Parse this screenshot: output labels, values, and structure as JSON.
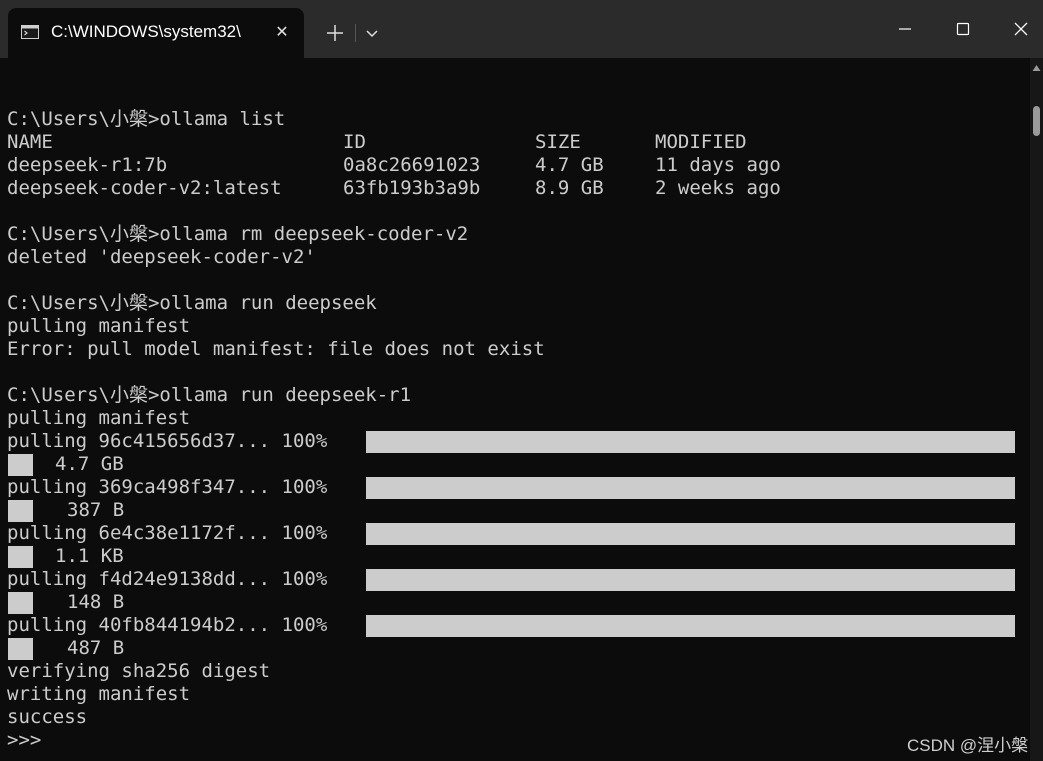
{
  "window": {
    "tab_title": "C:\\WINDOWS\\system32\\",
    "close_tab_glyph": "✕",
    "icons": [
      "terminal-icon",
      "close-icon",
      "plus-icon",
      "chevron-down-icon",
      "minimize-icon",
      "maximize-icon",
      "close-icon"
    ]
  },
  "terminal": {
    "prompt": "C:\\Users\\小槃>",
    "blocks": {
      "list_cmd": "C:\\Users\\小槃>ollama list",
      "list_headers": [
        "NAME",
        "ID",
        "SIZE",
        "MODIFIED"
      ],
      "list_rows": [
        [
          "deepseek-r1:7b",
          "0a8c26691023",
          "4.7 GB",
          "11 days ago"
        ],
        [
          "deepseek-coder-v2:latest",
          "63fb193b3a9b",
          "8.9 GB",
          "2 weeks ago"
        ]
      ],
      "rm_cmd": "C:\\Users\\小槃>ollama rm deepseek-coder-v2",
      "rm_out": "deleted 'deepseek-coder-v2'",
      "run1_cmd": "C:\\Users\\小槃>ollama run deepseek",
      "run1_out1": "pulling manifest",
      "run1_out2": "Error: pull model manifest: file does not exist",
      "run2_cmd": "C:\\Users\\小槃>ollama run deepseek-r1",
      "run2_out1": "pulling manifest",
      "pulls": [
        {
          "label": "pulling 96c415656d37... 100%",
          "size": "4.7 GB",
          "progress": 1.0
        },
        {
          "label": "pulling 369ca498f347... 100%",
          "size": "387 B",
          "progress": 1.0
        },
        {
          "label": "pulling 6e4c38e1172f... 100%",
          "size": "1.1 KB",
          "progress": 1.0
        },
        {
          "label": "pulling f4d24e9138dd... 100%",
          "size": "148 B",
          "progress": 1.0
        },
        {
          "label": "pulling 40fb844194b2... 100%",
          "size": "487 B",
          "progress": 1.0
        }
      ],
      "verify": "verifying sha256 digest",
      "write": "writing manifest",
      "success": "success",
      "repl_prompt": ">>>"
    }
  },
  "watermark": "CSDN @涅小槃",
  "colors": {
    "background": "#0c0c0c",
    "titlebar": "#2b2b2b",
    "text": "#cccccc",
    "progress": "#cccccc"
  }
}
